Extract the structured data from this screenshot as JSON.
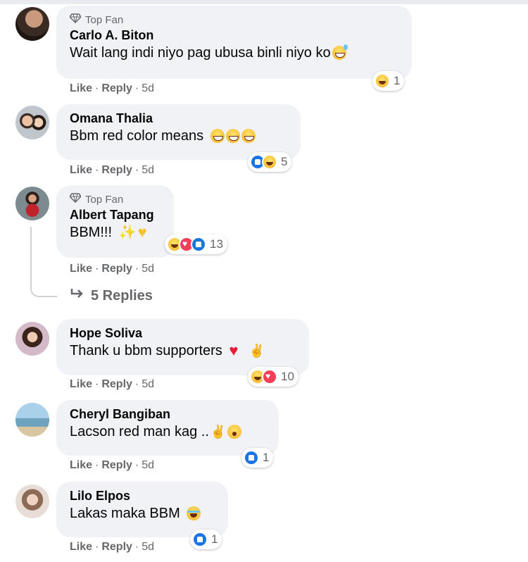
{
  "comments": [
    {
      "top_fan": "Top Fan",
      "name": "Carlo A. Biton",
      "text": "Wait lang indi niyo pag ubusa binli niyo ko",
      "reaction_count": "1",
      "like": "Like",
      "reply": "Reply",
      "time": "5d"
    },
    {
      "name": "Omana Thalia",
      "text": "Bbm red color means",
      "reaction_count": "5",
      "like": "Like",
      "reply": "Reply",
      "time": "5d"
    },
    {
      "top_fan": "Top Fan",
      "name": "Albert Tapang",
      "text": "BBM!!!",
      "reaction_count": "13",
      "like": "Like",
      "reply": "Reply",
      "time": "5d",
      "replies_label": "5 Replies"
    },
    {
      "name": "Hope Soliva",
      "text": "Thank u bbm supporters",
      "reaction_count": "10",
      "like": "Like",
      "reply": "Reply",
      "time": "5d"
    },
    {
      "name": "Cheryl Bangiban",
      "text": "Lacson red man kag ..",
      "reaction_count": "1",
      "like": "Like",
      "reply": "Reply",
      "time": "5d"
    },
    {
      "name": "Lilo Elpos",
      "text": "Lakas maka BBM",
      "reaction_count": "1",
      "like": "Like",
      "reply": "Reply",
      "time": "5d"
    }
  ],
  "colors": {
    "bubble": "#f0f2f5",
    "meta_text": "#65676b",
    "like_blue": "#1b74e4",
    "love_red": "#f33e58"
  },
  "icons": {
    "top_fan": "diamond-icon",
    "replies": "reply-arrow-icon"
  }
}
